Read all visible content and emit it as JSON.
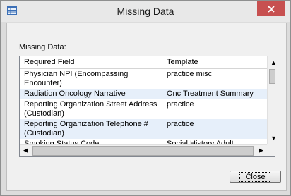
{
  "window": {
    "title": "Missing Data"
  },
  "dialog": {
    "section_label": "Missing Data:"
  },
  "table": {
    "columns": [
      "Required Field",
      "Template"
    ],
    "rows": [
      {
        "field": "Physician NPI (Encompassing Encounter)",
        "template": "practice misc"
      },
      {
        "field": "Radiation Oncology Narrative",
        "template": "Onc Treatment Summary"
      },
      {
        "field": "Reporting Organization Street Address  (Custodian)",
        "template": "practice"
      },
      {
        "field": "Reporting Organization Telephone # (Custodian)",
        "template": "practice"
      },
      {
        "field": "Smoking Status Code",
        "template": "Social History Adult"
      }
    ]
  },
  "buttons": {
    "close": "Close"
  },
  "icons": {
    "app": "window-list-icon",
    "close": "close-icon"
  },
  "colors": {
    "close_button": "#c75050",
    "alt_row": "#e6effa"
  }
}
